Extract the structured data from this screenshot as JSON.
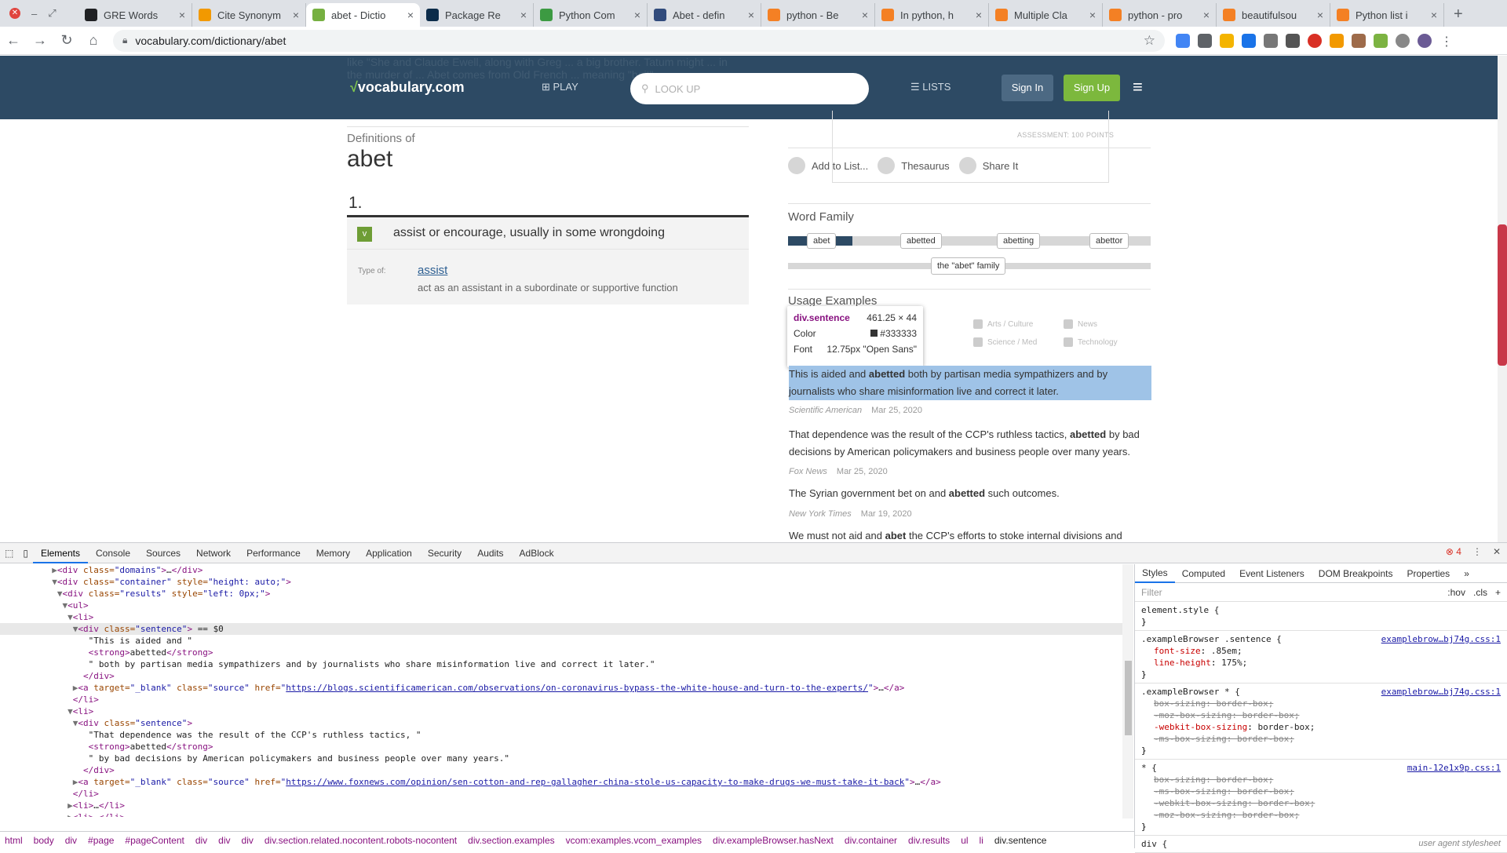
{
  "browser": {
    "tabs": [
      {
        "title": "GRE Words",
        "color": "#202124",
        "active": false
      },
      {
        "title": "Cite Synonym",
        "color": "#f29900",
        "active": false
      },
      {
        "title": "abet - Dictio",
        "color": "#76b041",
        "active": true
      },
      {
        "title": "Package Re",
        "color": "#0c2c4a",
        "active": false
      },
      {
        "title": "Python Com",
        "color": "#3c9a42",
        "active": false
      },
      {
        "title": "Abet - defin",
        "color": "#314b7c",
        "active": false
      },
      {
        "title": "python - Be",
        "color": "#f48024",
        "active": false
      },
      {
        "title": "In python, h",
        "color": "#f48024",
        "active": false
      },
      {
        "title": "Multiple Cla",
        "color": "#f48024",
        "active": false
      },
      {
        "title": "python - pro",
        "color": "#f48024",
        "active": false
      },
      {
        "title": "beautifulsou",
        "color": "#f48024",
        "active": false
      },
      {
        "title": "Python list i",
        "color": "#f48024",
        "active": false
      }
    ],
    "new_tab": "+",
    "url": "vocabulary.com/dictionary/abet"
  },
  "site": {
    "logo": "vocabulary.com",
    "play": "PLAY",
    "search_placeholder": "LOOK UP",
    "lists": "LISTS",
    "sign_in": "Sign In",
    "sign_up": "Sign Up",
    "faded_text": "like \"She and Claude Ewell, along with Greg ... a big brother. Tatum might ... in the murder of ... Abet comes from Old French ... meaning \"bait\"",
    "assessment": "ASSESSMENT: 100 POINTS"
  },
  "definition": {
    "label": "Definitions of",
    "word": "abet",
    "number": "1.",
    "pos": "v",
    "text": "assist or encourage, usually in some wrongdoing",
    "type_of_label": "Type of:",
    "type_of_word": "assist",
    "type_of_def": "act as an assistant in a subordinate or supportive function"
  },
  "actions": [
    "Add to List...",
    "Thesaurus",
    "Share It"
  ],
  "word_family": {
    "title": "Word Family",
    "members": [
      "abet",
      "abetted",
      "abetting",
      "abettor"
    ],
    "family_label": "the \"abet\" family"
  },
  "usage": {
    "title": "Usage Examples",
    "categories": [
      "Arts / Culture",
      "News",
      "Science / Med",
      "Technology"
    ],
    "tooltip": {
      "selector": "div.sentence",
      "size": "461.25 × 44",
      "color_label": "Color",
      "color_value": "#333333",
      "font_label": "Font",
      "font_value": "12.75px \"Open Sans\""
    },
    "examples": [
      {
        "pre": "This is aided and ",
        "strong": "abetted",
        "post": " both by partisan media sympathizers and by journalists who share misinformation live and correct it later.",
        "source": "Scientific American",
        "date": "Mar 25, 2020"
      },
      {
        "pre": "That dependence was the result of the CCP's ruthless tactics, ",
        "strong": "abetted",
        "post": " by bad decisions by American policymakers and business people over many years.",
        "source": "Fox News",
        "date": "Mar 25, 2020"
      },
      {
        "pre": "The Syrian government bet on and ",
        "strong": "abetted",
        "post": " such outcomes.",
        "source": "New York Times",
        "date": "Mar 19, 2020"
      },
      {
        "pre": "We must not aid and ",
        "strong": "abet",
        "post": " the CCP's efforts to stoke internal divisions and",
        "source": "",
        "date": ""
      }
    ]
  },
  "devtools": {
    "tabs": [
      "Elements",
      "Console",
      "Sources",
      "Network",
      "Performance",
      "Memory",
      "Application",
      "Security",
      "Audits",
      "AdBlock"
    ],
    "error_count": "4",
    "dom_lines": [
      {
        "indent": 10,
        "tri": "▶",
        "html": "<div class=\"domains\">…</div>"
      },
      {
        "indent": 10,
        "tri": "▼",
        "html": "<div class=\"container\" style=\"height: auto;\">"
      },
      {
        "indent": 11,
        "tri": "▼",
        "html": "<div class=\"results\" style=\"left: 0px;\">"
      },
      {
        "indent": 12,
        "tri": "▼",
        "html": "<ul>"
      },
      {
        "indent": 13,
        "tri": "▼",
        "html": "<li>"
      },
      {
        "indent": 14,
        "tri": "▼",
        "html": "<div class=\"sentence\"> == $0",
        "current": true
      },
      {
        "indent": 16,
        "tri": "",
        "html": "\"This is aided and \""
      },
      {
        "indent": 16,
        "tri": "",
        "html": "<strong>abetted</strong>"
      },
      {
        "indent": 16,
        "tri": "",
        "html": "\" both by partisan media sympathizers and by journalists who share misinformation live and correct it later.\""
      },
      {
        "indent": 15,
        "tri": "",
        "html": "</div>"
      },
      {
        "indent": 14,
        "tri": "▶",
        "html": "<a target=\"_blank\" class=\"source\" href=\"https://blogs.scientificamerican.com/observations/on-coronavirus-bypass-the-white-house-and-turn-to-the-experts/\">…</a>"
      },
      {
        "indent": 13,
        "tri": "",
        "html": "</li>"
      },
      {
        "indent": 13,
        "tri": "▼",
        "html": "<li>"
      },
      {
        "indent": 14,
        "tri": "▼",
        "html": "<div class=\"sentence\">"
      },
      {
        "indent": 16,
        "tri": "",
        "html": "\"That dependence was the result of the CCP's ruthless tactics, \""
      },
      {
        "indent": 16,
        "tri": "",
        "html": "<strong>abetted</strong>"
      },
      {
        "indent": 16,
        "tri": "",
        "html": "\" by bad decisions by American policymakers and business people over many years.\""
      },
      {
        "indent": 15,
        "tri": "",
        "html": "</div>"
      },
      {
        "indent": 14,
        "tri": "▶",
        "html": "<a target=\"_blank\" class=\"source\" href=\"https://www.foxnews.com/opinion/sen-cotton-and-rep-gallagher-china-stole-us-capacity-to-make-drugs-we-must-take-it-back\">…</a>"
      },
      {
        "indent": 13,
        "tri": "",
        "html": "</li>"
      },
      {
        "indent": 13,
        "tri": "▶",
        "html": "<li>…</li>"
      },
      {
        "indent": 13,
        "tri": "▶",
        "html": "<li>…</li>"
      },
      {
        "indent": 12,
        "tri": "",
        "html": "</ul>"
      }
    ],
    "breadcrumbs": [
      "html",
      "body",
      "div",
      "#page",
      "#pageContent",
      "div",
      "div",
      "div",
      "div.section.related.nocontent.robots-nocontent",
      "div.section.examples",
      "vcom:examples.vcom_examples",
      "div.exampleBrowser.hasNext",
      "div.container",
      "div.results",
      "ul",
      "li",
      "div.sentence"
    ],
    "styles_tabs": [
      "Styles",
      "Computed",
      "Event Listeners",
      "DOM Breakpoints",
      "Properties"
    ],
    "filter_placeholder": "Filter",
    "hov": ":hov",
    "cls": ".cls",
    "rules": [
      {
        "selector": "element.style {",
        "source": "",
        "props": []
      },
      {
        "selector": ".exampleBrowser .sentence {",
        "source": "examplebrow…bj74g.css:1",
        "props": [
          {
            "n": "font-size",
            "v": ".85em;",
            "struck": false
          },
          {
            "n": "line-height",
            "v": "175%;",
            "struck": false
          }
        ]
      },
      {
        "selector": ".exampleBrowser * {",
        "source": "examplebrow…bj74g.css:1",
        "props": [
          {
            "n": "box-sizing",
            "v": "border-box;",
            "struck": true
          },
          {
            "n": "-moz-box-sizing",
            "v": "border-box;",
            "struck": true
          },
          {
            "n": "-webkit-box-sizing",
            "v": "border-box;",
            "struck": false
          },
          {
            "n": "-ms-box-sizing",
            "v": "border-box;",
            "struck": true
          }
        ]
      },
      {
        "selector": "* {",
        "source": "main-12e1x9p.css:1",
        "props": [
          {
            "n": "box-sizing",
            "v": "border-box;",
            "struck": true
          },
          {
            "n": "-ms-box-sizing",
            "v": "border-box;",
            "struck": true
          },
          {
            "n": "-webkit-box-sizing",
            "v": "border-box;",
            "struck": true
          },
          {
            "n": "-moz-box-sizing",
            "v": "border-box;",
            "struck": true
          }
        ]
      },
      {
        "selector": "div {",
        "source": "user agent stylesheet",
        "props": []
      }
    ]
  }
}
